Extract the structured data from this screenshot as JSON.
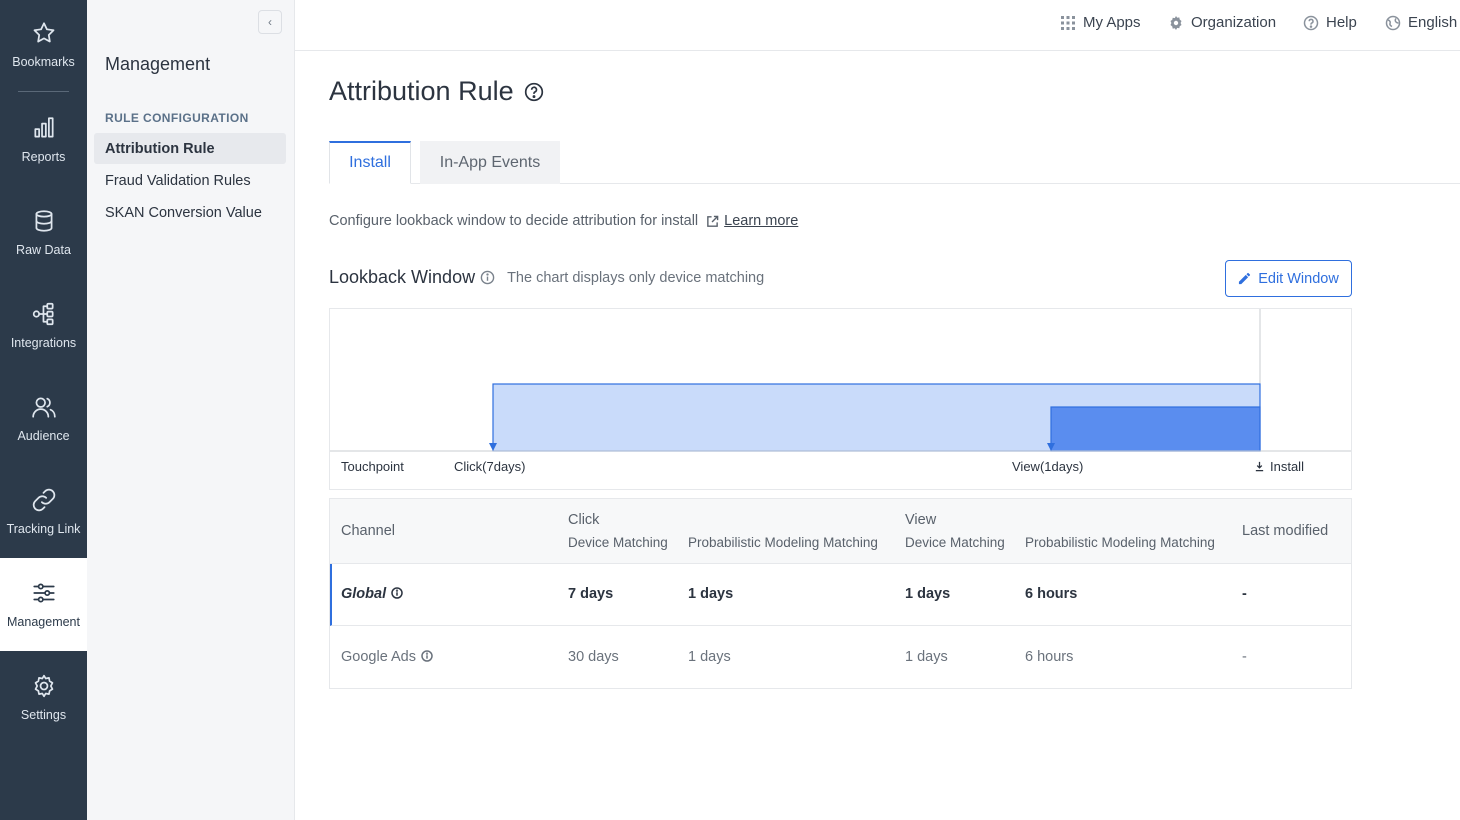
{
  "rail": {
    "items": [
      {
        "label": "Bookmarks",
        "icon": "star-icon"
      },
      {
        "label": "Reports",
        "icon": "bar-chart-icon"
      },
      {
        "label": "Raw Data",
        "icon": "database-icon"
      },
      {
        "label": "Integrations",
        "icon": "integrations-icon"
      },
      {
        "label": "Audience",
        "icon": "users-icon"
      },
      {
        "label": "Tracking Link",
        "icon": "link-icon"
      },
      {
        "label": "Management",
        "icon": "sliders-icon"
      },
      {
        "label": "Settings",
        "icon": "gear-icon"
      }
    ],
    "active": "Management"
  },
  "sidebar": {
    "title": "Management",
    "section": "RULE CONFIGURATION",
    "items": [
      {
        "label": "Attribution Rule"
      },
      {
        "label": "Fraud Validation Rules"
      },
      {
        "label": "SKAN Conversion Value"
      }
    ],
    "collapse_glyph": "‹"
  },
  "topbar": {
    "my_apps": "My Apps",
    "organization": "Organization",
    "help": "Help",
    "language": "English"
  },
  "page": {
    "title": "Attribution Rule",
    "tabs": [
      {
        "label": "Install"
      },
      {
        "label": "In-App Events"
      }
    ],
    "description": "Configure lookback window to decide attribution for install",
    "learn_more": "Learn more",
    "lookback_title": "Lookback Window",
    "lookback_subtitle": "The chart displays only device matching",
    "edit_button": "Edit Window"
  },
  "timeline": {
    "touchpoint_label": "Touchpoint",
    "click_label": "Click(7days)",
    "view_label": "View(1days)",
    "install_label": "Install",
    "click_days": 7,
    "view_days": 1,
    "colors": {
      "click": "#c9dbfa",
      "view": "#5a8def",
      "stroke": "#2f6fde"
    }
  },
  "table": {
    "headers": {
      "channel": "Channel",
      "click": "Click",
      "click_device": "Device Matching",
      "click_prob": "Probabilistic Modeling Matching",
      "view": "View",
      "view_device": "Device Matching",
      "view_prob": "Probabilistic Modeling Matching",
      "last_modified": "Last modified"
    },
    "rows": [
      {
        "channel": "Global",
        "click_device": "7 days",
        "click_prob": "1 days",
        "view_device": "1 days",
        "view_prob": "6 hours",
        "last_modified": "-"
      },
      {
        "channel": "Google Ads",
        "click_device": "30 days",
        "click_prob": "1 days",
        "view_device": "1 days",
        "view_prob": "6 hours",
        "last_modified": "-"
      }
    ]
  }
}
